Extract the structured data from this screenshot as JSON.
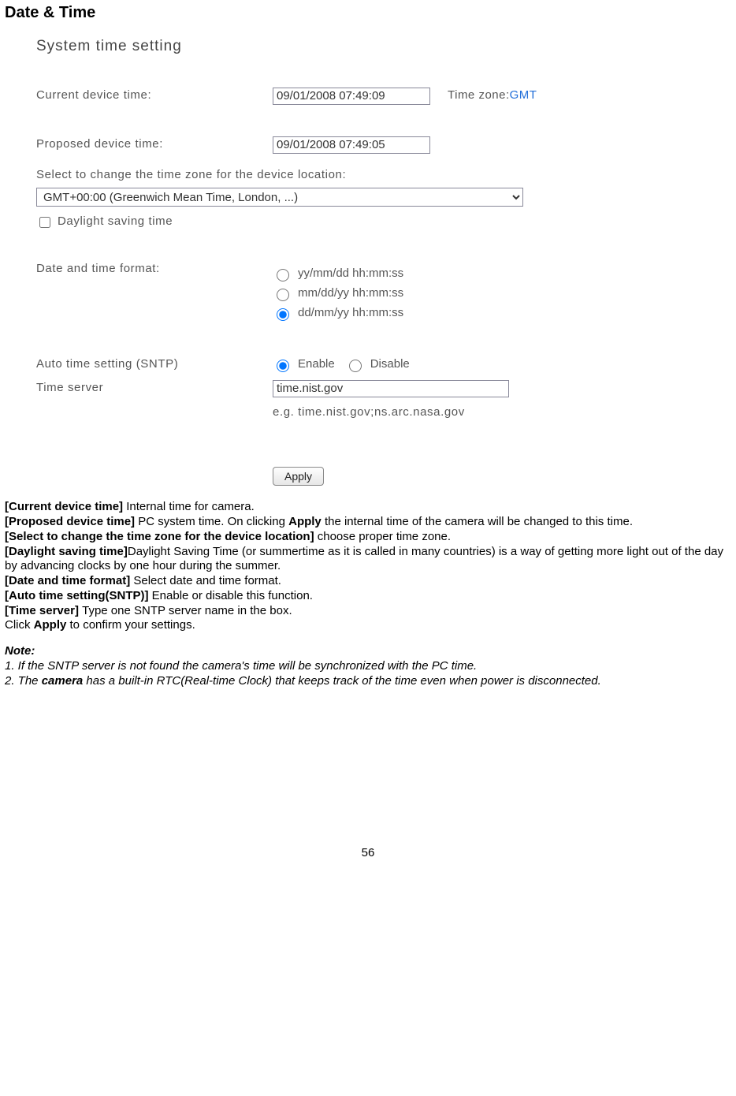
{
  "page_title": "Date & Time",
  "page_number": "56",
  "screenshot": {
    "header": "System time setting",
    "current_device_time_label": "Current device time:",
    "current_device_time_value": "09/01/2008 07:49:09",
    "time_zone_label": "Time zone:",
    "time_zone_link": "GMT",
    "proposed_device_time_label": "Proposed device time:",
    "proposed_device_time_value": "09/01/2008 07:49:05",
    "select_tz_caption": "Select to change the time zone for the device location:",
    "tz_select_value": "GMT+00:00 (Greenwich Mean Time, London, ...)",
    "dst_label": "Daylight saving time",
    "dst_checked": false,
    "date_format_label": "Date and time format:",
    "date_formats": {
      "opt1": "yy/mm/dd hh:mm:ss",
      "opt2": "mm/dd/yy hh:mm:ss",
      "opt3": "dd/mm/yy hh:mm:ss"
    },
    "sntp_label": "Auto time setting (SNTP)",
    "sntp_enable": "Enable",
    "sntp_disable": "Disable",
    "time_server_label": "Time server",
    "time_server_value": "time.nist.gov",
    "time_server_example": "e.g. time.nist.gov;ns.arc.nasa.gov",
    "apply_label": "Apply"
  },
  "doc": {
    "cdt_label": "[Current device time] ",
    "cdt_text": "Internal time for camera.",
    "pdt_label": "[Proposed device time] ",
    "pdt_text_a": "PC system time. On clicking ",
    "pdt_apply": "Apply",
    "pdt_text_b": " the internal time of the camera will be changed to this time.",
    "tz_label": "[Select to change the time zone for the device location] ",
    "tz_text": "choose proper time zone.",
    "dst_label": "[Daylight saving time]",
    "dst_text": "Daylight Saving Time (or summertime as it is called in many countries) is a way of getting more light out of the day by advancing clocks by one hour during the summer.",
    "fmt_label": "[Date and time format] ",
    "fmt_text": "Select date and time format.",
    "sntp_label": "[Auto time setting(SNTP)] ",
    "sntp_text": "Enable or disable this function.",
    "ts_label": "[Time server] ",
    "ts_text": "Type one SNTP server name in the box.",
    "click_a": "Click ",
    "click_apply": "Apply",
    "click_b": " to confirm your settings.",
    "note_hdr": "Note:",
    "note1": "1. If the SNTP server is not found the camera's time will be synchronized with the PC time.",
    "note2a": "2. The ",
    "note2b": "camera",
    "note2c": " has a built-in RTC(Real-time Clock) that keeps track of the time even when power is disconnected."
  }
}
